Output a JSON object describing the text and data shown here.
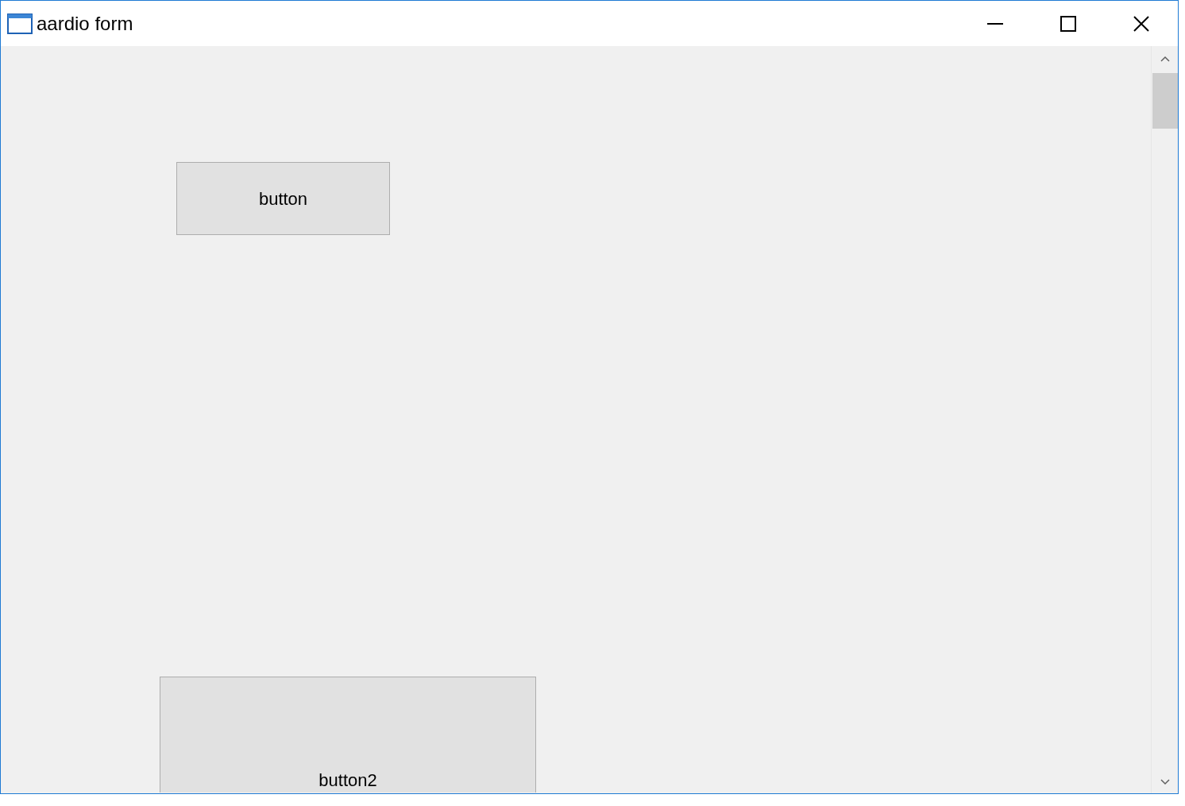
{
  "window": {
    "title": "aardio form"
  },
  "buttons": [
    {
      "label": "button"
    },
    {
      "label": "button2"
    }
  ]
}
